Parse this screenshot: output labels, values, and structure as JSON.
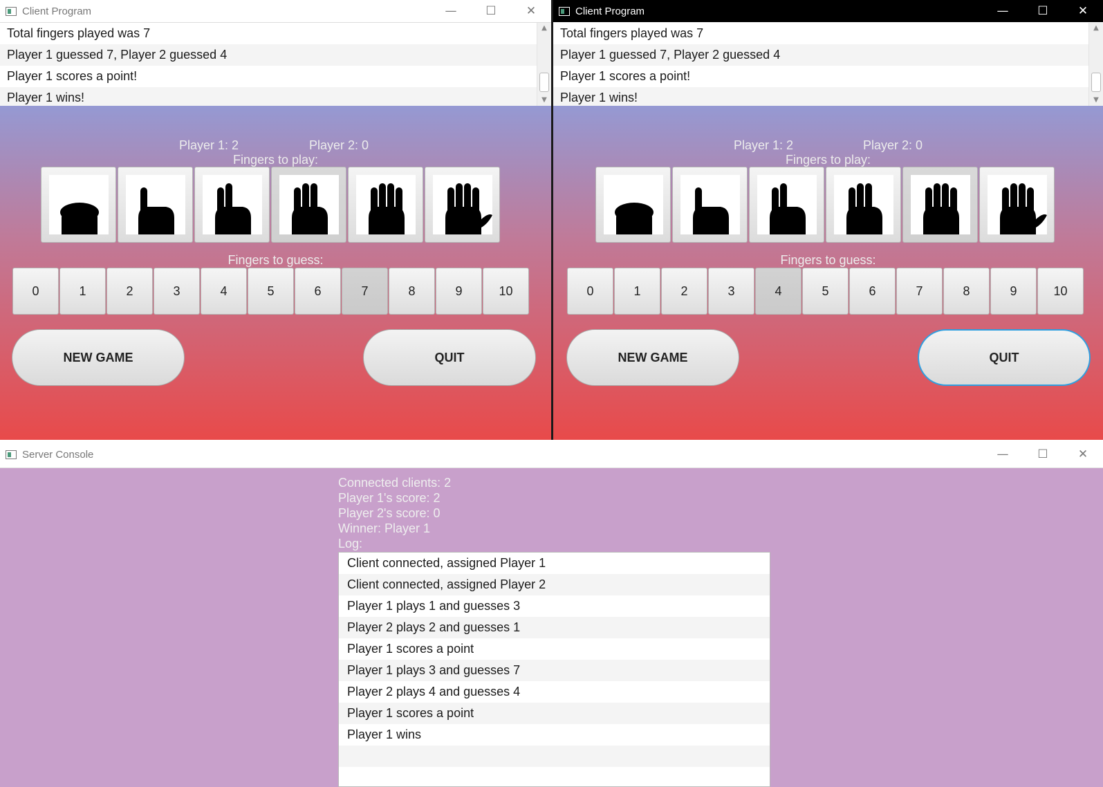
{
  "client_left": {
    "title": "Client Program",
    "log": [
      "Total fingers played was 7",
      "Player 1 guessed 7, Player 2 guessed 4",
      "Player 1 scores a point!",
      "Player 1 wins!"
    ],
    "player1_score": "Player 1: 2",
    "player2_score": "Player 2: 0",
    "fingers_to_play_label": "Fingers to play:",
    "fingers_to_guess_label": "Fingers to guess:",
    "selected_play": 3,
    "selected_guess": 7,
    "new_game_label": "NEW GAME",
    "quit_label": "QUIT"
  },
  "client_right": {
    "title": "Client Program",
    "log": [
      "Total fingers played was 7",
      "Player 1 guessed 7, Player 2 guessed 4",
      "Player 1 scores a point!",
      "Player 1 wins!"
    ],
    "player1_score": "Player 1: 2",
    "player2_score": "Player 2: 0",
    "fingers_to_play_label": "Fingers to play:",
    "fingers_to_guess_label": "Fingers to guess:",
    "selected_play": 4,
    "selected_guess": 4,
    "new_game_label": "NEW GAME",
    "quit_label": "QUIT"
  },
  "guess_options": [
    "0",
    "1",
    "2",
    "3",
    "4",
    "5",
    "6",
    "7",
    "8",
    "9",
    "10"
  ],
  "hand_icons": [
    "fist-icon",
    "one-finger-icon",
    "two-fingers-icon",
    "three-fingers-icon",
    "four-fingers-icon",
    "five-fingers-icon"
  ],
  "server": {
    "title": "Server Console",
    "connected_clients": "Connected clients: 2",
    "player1_score": "Player 1's score: 2",
    "player2_score": "Player 2's score: 0",
    "winner": "Winner: Player 1",
    "log_label": "Log:",
    "log": [
      "Client connected, assigned Player 1",
      "Client connected, assigned Player 2",
      "Player 1 plays 1 and guesses 3",
      "Player 2 plays 2 and guesses 1",
      "Player 1 scores a point",
      "Player 1 plays 3 and guesses 7",
      "Player 2 plays 4 and guesses 4",
      "Player 1 scores a point",
      "Player 1 wins"
    ]
  },
  "colors": {
    "gradient_top": "#9599d3",
    "gradient_bottom": "#e84a4a",
    "server_bg": "#c8a0cb",
    "focus_ring": "#2f9fe0"
  }
}
